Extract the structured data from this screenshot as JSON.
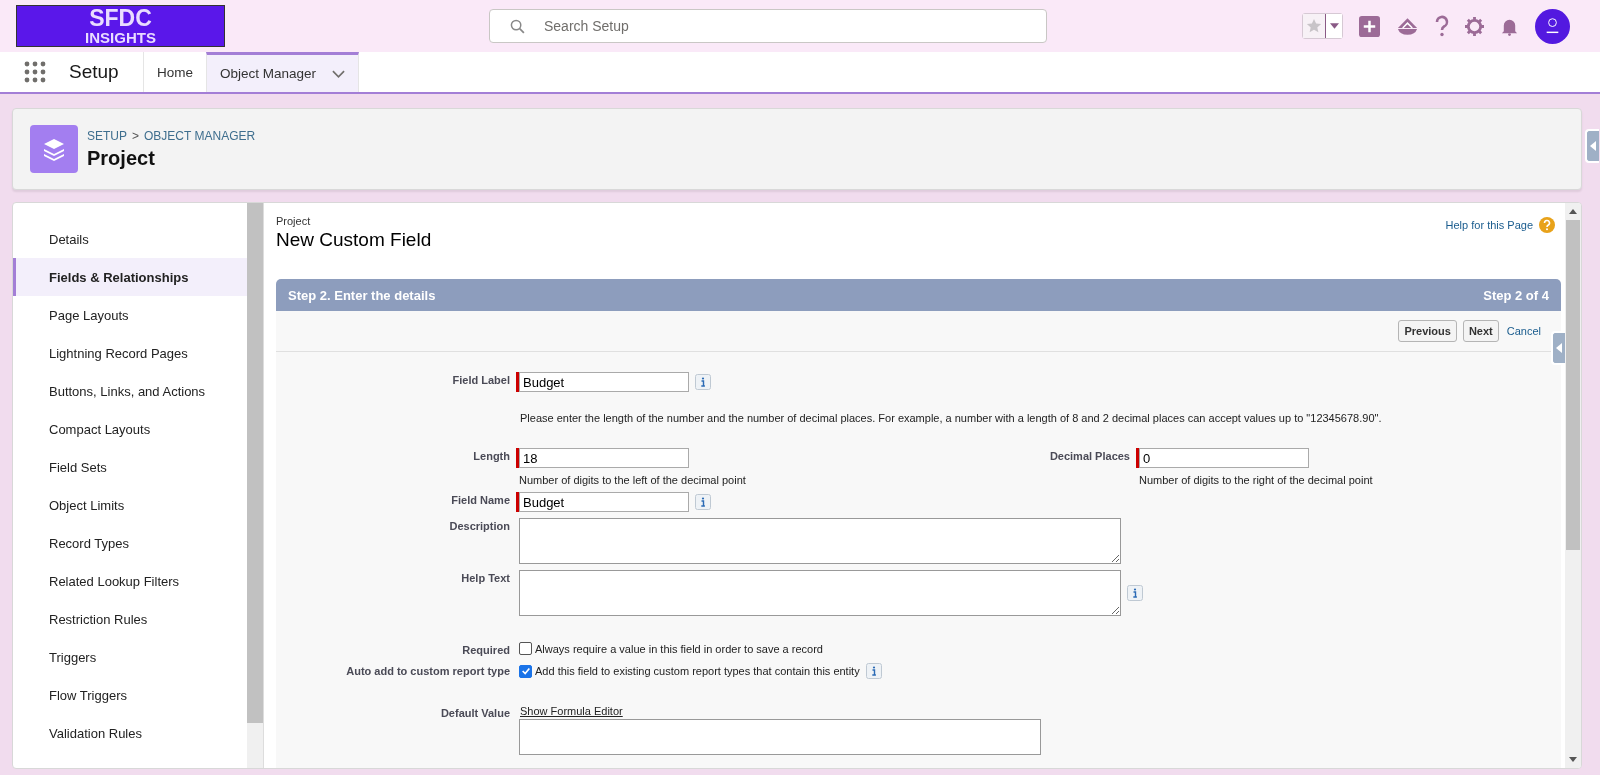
{
  "header": {
    "logo_line_1": "SFDC",
    "logo_line_2": "INSIGHTS",
    "search": {
      "placeholder": "Search Setup"
    }
  },
  "nav": {
    "app_name": "Setup",
    "tabs": [
      {
        "label": "Home",
        "selected": false,
        "has_menu": false
      },
      {
        "label": "Object Manager",
        "selected": true,
        "has_menu": true
      }
    ]
  },
  "object_header": {
    "breadcrumbs": [
      "SETUP",
      "OBJECT MANAGER"
    ],
    "separator": ">",
    "title": "Project"
  },
  "sidebar": {
    "items": [
      {
        "label": "Details",
        "selected": false
      },
      {
        "label": "Fields & Relationships",
        "selected": true
      },
      {
        "label": "Page Layouts",
        "selected": false
      },
      {
        "label": "Lightning Record Pages",
        "selected": false
      },
      {
        "label": "Buttons, Links, and Actions",
        "selected": false
      },
      {
        "label": "Compact Layouts",
        "selected": false
      },
      {
        "label": "Field Sets",
        "selected": false
      },
      {
        "label": "Object Limits",
        "selected": false
      },
      {
        "label": "Record Types",
        "selected": false
      },
      {
        "label": "Related Lookup Filters",
        "selected": false
      },
      {
        "label": "Restriction Rules",
        "selected": false
      },
      {
        "label": "Triggers",
        "selected": false
      },
      {
        "label": "Flow Triggers",
        "selected": false
      },
      {
        "label": "Validation Rules",
        "selected": false
      }
    ]
  },
  "page": {
    "object_name": "Project",
    "title": "New Custom Field",
    "help_link": "Help for this Page",
    "step": {
      "title": "Step 2. Enter the details",
      "counter": "Step 2 of 4"
    },
    "buttons": [
      {
        "label": "Previous",
        "kind": "button"
      },
      {
        "label": "Next",
        "kind": "button"
      },
      {
        "label": "Cancel",
        "kind": "link"
      }
    ]
  },
  "form": [
    {
      "kind": "text",
      "label": "Field Label",
      "value": "Budget",
      "required": true,
      "info": true
    },
    {
      "kind": "instructions",
      "text": "Please enter the length of the number and the number of decimal places. For example, a number with a length of 8 and 2 decimal places can accept values up to \"12345678.90\"."
    },
    {
      "kind": "pair",
      "fields": [
        {
          "label": "Length",
          "value": "18",
          "required": true,
          "hint": "Number of digits to the left of the decimal point"
        },
        {
          "label": "Decimal Places",
          "value": "0",
          "required": true,
          "hint": "Number of digits to the right of the decimal point"
        }
      ]
    },
    {
      "kind": "text",
      "label": "Field Name",
      "value": "Budget",
      "required": true,
      "info": true
    },
    {
      "kind": "textarea",
      "label": "Description",
      "info": false
    },
    {
      "kind": "textarea",
      "label": "Help Text",
      "info": true
    },
    {
      "kind": "checkbox",
      "label": "Required",
      "text": "Always require a value in this field in order to save a record",
      "checked": false,
      "info": false
    },
    {
      "kind": "checkbox",
      "label": "Auto add to custom report type",
      "text": "Add this field to existing custom report types that contain this entity",
      "checked": true,
      "info": true
    },
    {
      "kind": "formula",
      "label": "Default Value",
      "link": "Show Formula Editor"
    }
  ]
}
